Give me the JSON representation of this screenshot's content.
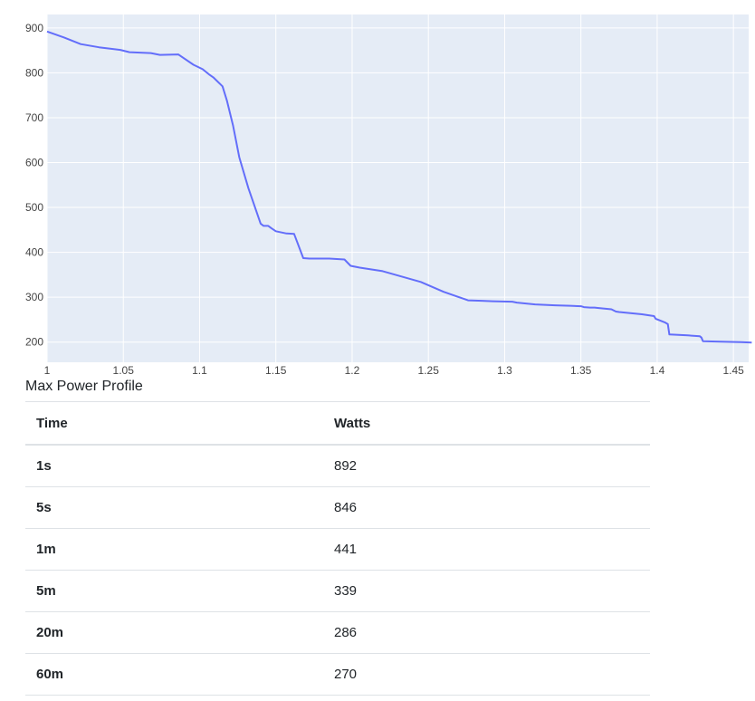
{
  "chart_data": {
    "type": "line",
    "title": "",
    "xlabel": "",
    "ylabel": "",
    "xlim": [
      1,
      1.46
    ],
    "ylim": [
      155,
      930
    ],
    "x_ticks": [
      1,
      1.05,
      1.1,
      1.15,
      1.2,
      1.25,
      1.3,
      1.35,
      1.4,
      1.45
    ],
    "x_tick_labels": [
      "1",
      "1.05",
      "1.1",
      "1.15",
      "1.2",
      "1.25",
      "1.3",
      "1.35",
      "1.4",
      "1.45"
    ],
    "y_ticks": [
      200,
      300,
      400,
      500,
      600,
      700,
      800,
      900
    ],
    "y_tick_labels": [
      "200",
      "300",
      "400",
      "500",
      "600",
      "700",
      "800",
      "900"
    ],
    "grid": true,
    "background": "#e5ecf6",
    "series": [
      {
        "color": "#636efa",
        "x": [
          1.0,
          1.011,
          1.022,
          1.034,
          1.048,
          1.054,
          1.068,
          1.074,
          1.086,
          1.096,
          1.102,
          1.106,
          1.109,
          1.115,
          1.118,
          1.122,
          1.126,
          1.132,
          1.14,
          1.142,
          1.145,
          1.147,
          1.15,
          1.157,
          1.162,
          1.168,
          1.172,
          1.185,
          1.195,
          1.199,
          1.205,
          1.22,
          1.245,
          1.26,
          1.276,
          1.285,
          1.292,
          1.305,
          1.308,
          1.32,
          1.333,
          1.343,
          1.35,
          1.352,
          1.356,
          1.359,
          1.361,
          1.37,
          1.373,
          1.375,
          1.39,
          1.398,
          1.399,
          1.405,
          1.407,
          1.408,
          1.42,
          1.428,
          1.429,
          1.43,
          1.442,
          1.455,
          1.462
        ],
        "y": [
          892,
          879,
          864,
          857,
          851,
          846,
          844,
          840,
          841,
          818,
          808,
          797,
          790,
          770,
          737,
          682,
          612,
          543,
          464,
          459,
          459,
          454,
          447,
          442,
          441,
          387,
          386,
          386,
          384,
          370,
          366,
          358,
          334,
          312,
          293,
          292,
          291,
          290,
          288,
          284,
          282,
          281,
          280,
          278,
          277,
          277,
          276,
          273,
          268,
          267,
          262,
          258,
          252,
          244,
          240,
          217,
          215,
          213,
          210,
          202,
          201,
          200,
          199
        ]
      }
    ]
  },
  "table": {
    "caption": "Max Power Profile",
    "headers": [
      "Time",
      "Watts"
    ],
    "rows": [
      {
        "time": "1s",
        "watts": "892"
      },
      {
        "time": "5s",
        "watts": "846"
      },
      {
        "time": "1m",
        "watts": "441"
      },
      {
        "time": "5m",
        "watts": "339"
      },
      {
        "time": "20m",
        "watts": "286"
      },
      {
        "time": "60m",
        "watts": "270"
      }
    ]
  }
}
